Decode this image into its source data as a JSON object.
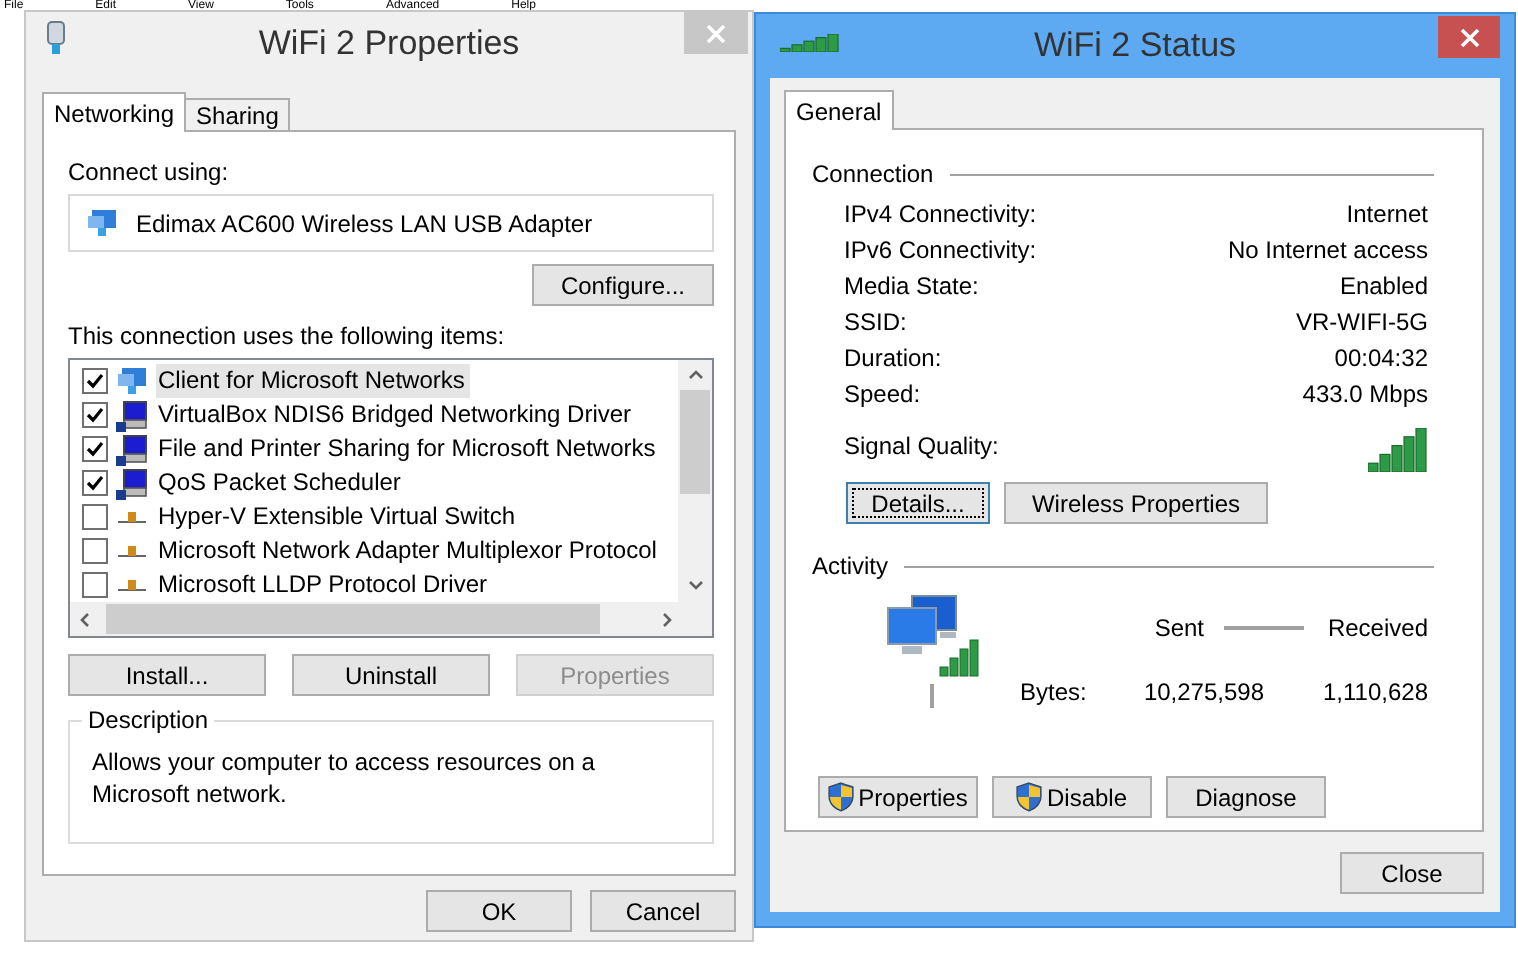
{
  "background_menu": [
    "File",
    "Edit",
    "View",
    "Tools",
    "Advanced",
    "Help"
  ],
  "properties_window": {
    "title": "WiFi 2 Properties",
    "tabs": [
      {
        "label": "Networking",
        "selected": true
      },
      {
        "label": "Sharing",
        "selected": false
      }
    ],
    "connect_using_label": "Connect using:",
    "adapter": "Edimax AC600 Wireless LAN USB Adapter",
    "configure_button": "Configure...",
    "items_label": "This connection uses the following items:",
    "items": [
      {
        "label": "Client for Microsoft Networks",
        "checked": true,
        "selected": true,
        "kind": "client"
      },
      {
        "label": "VirtualBox NDIS6 Bridged Networking Driver",
        "checked": true,
        "selected": false,
        "kind": "service"
      },
      {
        "label": "File and Printer Sharing for Microsoft Networks",
        "checked": true,
        "selected": false,
        "kind": "service"
      },
      {
        "label": "QoS Packet Scheduler",
        "checked": true,
        "selected": false,
        "kind": "service"
      },
      {
        "label": "Hyper-V Extensible Virtual Switch",
        "checked": false,
        "selected": false,
        "kind": "protocol"
      },
      {
        "label": "Microsoft Network Adapter Multiplexor Protocol",
        "checked": false,
        "selected": false,
        "kind": "protocol"
      },
      {
        "label": "Microsoft LLDP Protocol Driver",
        "checked": false,
        "selected": false,
        "kind": "protocol"
      }
    ],
    "item_buttons": [
      {
        "label": "Install...",
        "disabled": false
      },
      {
        "label": "Uninstall",
        "disabled": false
      },
      {
        "label": "Properties",
        "disabled": true
      }
    ],
    "description": {
      "title": "Description",
      "text": "Allows your computer to access resources on a Microsoft network."
    },
    "footer_buttons": [
      "OK",
      "Cancel"
    ]
  },
  "status_window": {
    "title": "WiFi 2 Status",
    "tabs": [
      {
        "label": "General",
        "selected": true
      }
    ],
    "connection_title": "Connection",
    "rows": [
      {
        "label": "IPv4 Connectivity:",
        "value": "Internet"
      },
      {
        "label": "IPv6 Connectivity:",
        "value": "No Internet access"
      },
      {
        "label": "Media State:",
        "value": "Enabled"
      },
      {
        "label": "SSID:",
        "value": "VR-WIFI-5G"
      },
      {
        "label": "Duration:",
        "value": "00:04:32"
      },
      {
        "label": "Speed:",
        "value": "433.0 Mbps"
      }
    ],
    "signal_label": "Signal Quality:",
    "connection_buttons": [
      "Details...",
      "Wireless Properties"
    ],
    "activity_title": "Activity",
    "sent_label": "Sent",
    "received_label": "Received",
    "bytes_label": "Bytes:",
    "sent_value": "10,275,598",
    "received_value": "1,110,628",
    "activity_buttons": [
      {
        "label": "Properties",
        "kind": "shield"
      },
      {
        "label": "Disable",
        "kind": "shield"
      },
      {
        "label": "Diagnose",
        "kind": "plain"
      }
    ],
    "close_button": "Close"
  }
}
